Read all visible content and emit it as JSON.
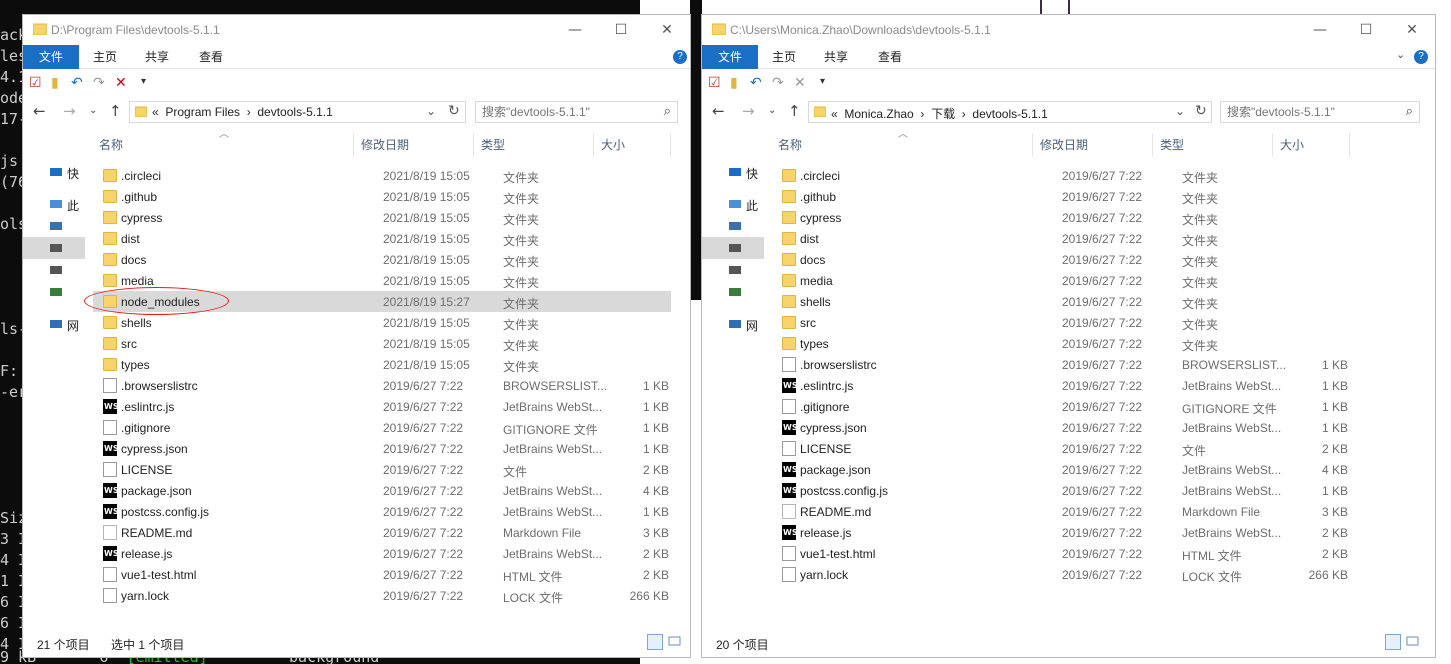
{
  "terminal": {
    "lines": [
      "ack",
      "les",
      "4.1",
      "ode",
      "17-",
      "",
      "js",
      "(76",
      "",
      "ols",
      "",
      "",
      "",
      "",
      "ls-",
      "",
      "F:",
      "-er",
      "",
      "",
      "",
      "",
      "",
      "Siz",
      "3 I",
      "4 I",
      "1 I",
      "6 I",
      "6 I",
      "4 I"
    ],
    "bottom_line": {
      "size": "9 kB",
      "chunks": "6",
      "emitted": "[emitted]",
      "name": "background"
    }
  },
  "left": {
    "title": "D:\\Program Files\\devtools-5.1.1",
    "ribbon": {
      "file": "文件",
      "home": "主页",
      "share": "共享",
      "view": "查看"
    },
    "breadcrumb": [
      "Program Files",
      "devtools-5.1.1"
    ],
    "search_placeholder": "搜索\"devtools-5.1.1\"",
    "nav": [
      "快",
      "此",
      "",
      "",
      "",
      "",
      "网"
    ],
    "columns": {
      "name": "名称",
      "date": "修改日期",
      "type": "类型",
      "size": "大小"
    },
    "files": [
      {
        "name": ".circleci",
        "date": "2021/8/19 15:05",
        "type": "文件夹",
        "size": "",
        "icon": "folder"
      },
      {
        "name": ".github",
        "date": "2021/8/19 15:05",
        "type": "文件夹",
        "size": "",
        "icon": "folder"
      },
      {
        "name": "cypress",
        "date": "2021/8/19 15:05",
        "type": "文件夹",
        "size": "",
        "icon": "folder"
      },
      {
        "name": "dist",
        "date": "2021/8/19 15:05",
        "type": "文件夹",
        "size": "",
        "icon": "folder"
      },
      {
        "name": "docs",
        "date": "2021/8/19 15:05",
        "type": "文件夹",
        "size": "",
        "icon": "folder"
      },
      {
        "name": "media",
        "date": "2021/8/19 15:05",
        "type": "文件夹",
        "size": "",
        "icon": "folder"
      },
      {
        "name": "node_modules",
        "date": "2021/8/19 15:27",
        "type": "文件夹",
        "size": "",
        "icon": "folder",
        "selected": true
      },
      {
        "name": "shells",
        "date": "2021/8/19 15:05",
        "type": "文件夹",
        "size": "",
        "icon": "folder"
      },
      {
        "name": "src",
        "date": "2021/8/19 15:05",
        "type": "文件夹",
        "size": "",
        "icon": "folder"
      },
      {
        "name": "types",
        "date": "2021/8/19 15:05",
        "type": "文件夹",
        "size": "",
        "icon": "folder"
      },
      {
        "name": ".browserslistrc",
        "date": "2019/6/27 7:22",
        "type": "BROWSERSLIST...",
        "size": "1 KB",
        "icon": "file"
      },
      {
        "name": ".eslintrc.js",
        "date": "2019/6/27 7:22",
        "type": "JetBrains WebSt...",
        "size": "1 KB",
        "icon": "ws"
      },
      {
        "name": ".gitignore",
        "date": "2019/6/27 7:22",
        "type": "GITIGNORE 文件",
        "size": "1 KB",
        "icon": "file"
      },
      {
        "name": "cypress.json",
        "date": "2019/6/27 7:22",
        "type": "JetBrains WebSt...",
        "size": "1 KB",
        "icon": "ws"
      },
      {
        "name": "LICENSE",
        "date": "2019/6/27 7:22",
        "type": "文件",
        "size": "2 KB",
        "icon": "file"
      },
      {
        "name": "package.json",
        "date": "2019/6/27 7:22",
        "type": "JetBrains WebSt...",
        "size": "4 KB",
        "icon": "ws"
      },
      {
        "name": "postcss.config.js",
        "date": "2019/6/27 7:22",
        "type": "JetBrains WebSt...",
        "size": "1 KB",
        "icon": "ws"
      },
      {
        "name": "README.md",
        "date": "2019/6/27 7:22",
        "type": "Markdown File",
        "size": "3 KB",
        "icon": "md"
      },
      {
        "name": "release.js",
        "date": "2019/6/27 7:22",
        "type": "JetBrains WebSt...",
        "size": "2 KB",
        "icon": "ws"
      },
      {
        "name": "vue1-test.html",
        "date": "2019/6/27 7:22",
        "type": "HTML 文件",
        "size": "2 KB",
        "icon": "file"
      },
      {
        "name": "yarn.lock",
        "date": "2019/6/27 7:22",
        "type": "LOCK 文件",
        "size": "266 KB",
        "icon": "file"
      }
    ],
    "status": {
      "count": "21 个项目",
      "selected": "选中 1 个项目"
    }
  },
  "right": {
    "title": "C:\\Users\\Monica.Zhao\\Downloads\\devtools-5.1.1",
    "ribbon": {
      "file": "文件",
      "home": "主页",
      "share": "共享",
      "view": "查看"
    },
    "breadcrumb": [
      "Monica.Zhao",
      "下载",
      "devtools-5.1.1"
    ],
    "search_placeholder": "搜索\"devtools-5.1.1\"",
    "nav": [
      "快",
      "此",
      "",
      "",
      "",
      "",
      "网"
    ],
    "columns": {
      "name": "名称",
      "date": "修改日期",
      "type": "类型",
      "size": "大小"
    },
    "files": [
      {
        "name": ".circleci",
        "date": "2019/6/27 7:22",
        "type": "文件夹",
        "size": "",
        "icon": "folder"
      },
      {
        "name": ".github",
        "date": "2019/6/27 7:22",
        "type": "文件夹",
        "size": "",
        "icon": "folder"
      },
      {
        "name": "cypress",
        "date": "2019/6/27 7:22",
        "type": "文件夹",
        "size": "",
        "icon": "folder"
      },
      {
        "name": "dist",
        "date": "2019/6/27 7:22",
        "type": "文件夹",
        "size": "",
        "icon": "folder"
      },
      {
        "name": "docs",
        "date": "2019/6/27 7:22",
        "type": "文件夹",
        "size": "",
        "icon": "folder"
      },
      {
        "name": "media",
        "date": "2019/6/27 7:22",
        "type": "文件夹",
        "size": "",
        "icon": "folder"
      },
      {
        "name": "shells",
        "date": "2019/6/27 7:22",
        "type": "文件夹",
        "size": "",
        "icon": "folder"
      },
      {
        "name": "src",
        "date": "2019/6/27 7:22",
        "type": "文件夹",
        "size": "",
        "icon": "folder"
      },
      {
        "name": "types",
        "date": "2019/6/27 7:22",
        "type": "文件夹",
        "size": "",
        "icon": "folder"
      },
      {
        "name": ".browserslistrc",
        "date": "2019/6/27 7:22",
        "type": "BROWSERSLIST...",
        "size": "1 KB",
        "icon": "file"
      },
      {
        "name": ".eslintrc.js",
        "date": "2019/6/27 7:22",
        "type": "JetBrains WebSt...",
        "size": "1 KB",
        "icon": "ws"
      },
      {
        "name": ".gitignore",
        "date": "2019/6/27 7:22",
        "type": "GITIGNORE 文件",
        "size": "1 KB",
        "icon": "file"
      },
      {
        "name": "cypress.json",
        "date": "2019/6/27 7:22",
        "type": "JetBrains WebSt...",
        "size": "1 KB",
        "icon": "ws"
      },
      {
        "name": "LICENSE",
        "date": "2019/6/27 7:22",
        "type": "文件",
        "size": "2 KB",
        "icon": "file"
      },
      {
        "name": "package.json",
        "date": "2019/6/27 7:22",
        "type": "JetBrains WebSt...",
        "size": "4 KB",
        "icon": "ws"
      },
      {
        "name": "postcss.config.js",
        "date": "2019/6/27 7:22",
        "type": "JetBrains WebSt...",
        "size": "1 KB",
        "icon": "ws"
      },
      {
        "name": "README.md",
        "date": "2019/6/27 7:22",
        "type": "Markdown File",
        "size": "3 KB",
        "icon": "md"
      },
      {
        "name": "release.js",
        "date": "2019/6/27 7:22",
        "type": "JetBrains WebSt...",
        "size": "2 KB",
        "icon": "ws"
      },
      {
        "name": "vue1-test.html",
        "date": "2019/6/27 7:22",
        "type": "HTML 文件",
        "size": "2 KB",
        "icon": "file"
      },
      {
        "name": "yarn.lock",
        "date": "2019/6/27 7:22",
        "type": "LOCK 文件",
        "size": "266 KB",
        "icon": "file"
      }
    ],
    "status": {
      "count": "20 个项目",
      "selected": ""
    }
  },
  "colors": {
    "accent": "#1a6fc4",
    "selected_row": "#d9d9d9",
    "annotation": "#e21b1b",
    "folder": "#f7d36b"
  }
}
